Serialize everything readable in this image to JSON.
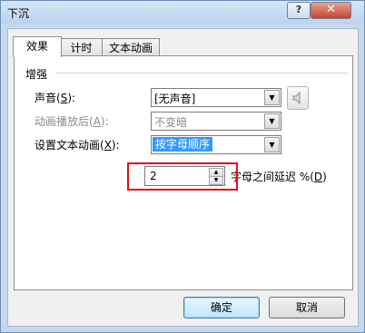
{
  "window": {
    "title": "下沉"
  },
  "titlebar": {
    "help_label": "?",
    "close_label": "✕"
  },
  "tabs": [
    {
      "label": "效果",
      "active": true
    },
    {
      "label": "计时",
      "active": false
    },
    {
      "label": "文本动画",
      "active": false
    }
  ],
  "group": {
    "title": "增强"
  },
  "fields": {
    "sound": {
      "label_pre": "声音(",
      "hotkey": "S",
      "label_post": "):",
      "value": "[无声音]"
    },
    "after_animation": {
      "label_pre": "动画播放后(",
      "hotkey": "A",
      "label_post": "):",
      "value": "不变暗",
      "disabled": true
    },
    "animate_text": {
      "label_pre": "设置文本动画(",
      "hotkey": "X",
      "label_post": "):",
      "value": "按字母顺序"
    },
    "delay": {
      "value": "2",
      "suffix_pre": "字母之间延迟 %(",
      "hotkey": "D",
      "suffix_post": ")"
    }
  },
  "icons": {
    "sound": "speaker-icon",
    "spin_up": "spin-up-icon",
    "spin_down": "spin-down-icon",
    "dropdown": "chevron-down-icon"
  },
  "buttons": {
    "ok": "确定",
    "cancel": "取消"
  },
  "colors": {
    "highlight": "#e01010",
    "selection": "#3399ff",
    "titlebar": "#c4d9ef",
    "close": "#c7422a"
  }
}
